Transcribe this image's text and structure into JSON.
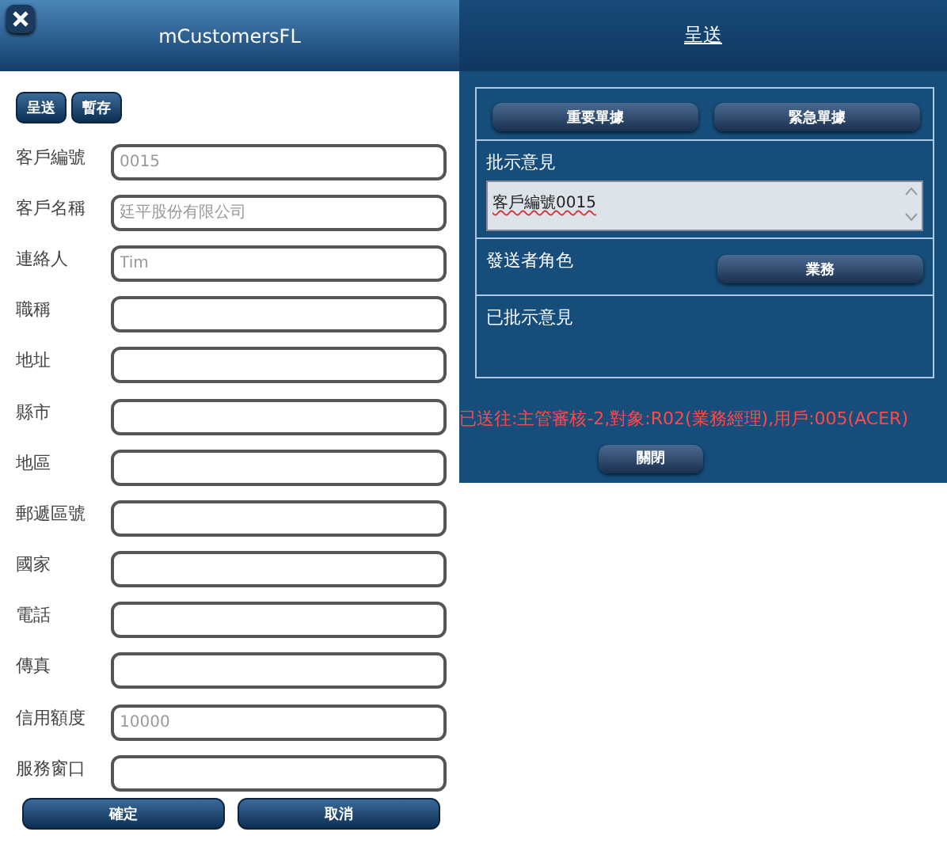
{
  "left": {
    "title": "mCustomersFL",
    "toolbar": [
      "呈送",
      "暫存"
    ],
    "fields": [
      {
        "label": "客戶編號",
        "value": "0015"
      },
      {
        "label": "客戶名稱",
        "value": "廷平股份有限公司"
      },
      {
        "label": "連絡人",
        "value": "Tim"
      },
      {
        "label": "職稱"
      },
      {
        "label": "地址"
      },
      {
        "label": "縣市"
      },
      {
        "label": "地區"
      },
      {
        "label": "郵遞區號"
      },
      {
        "label": "國家"
      },
      {
        "label": "電話"
      },
      {
        "label": "傳真"
      },
      {
        "label": "信用額度",
        "value": "10000"
      },
      {
        "label": "服務窗口"
      }
    ],
    "buttons": [
      "確定",
      "取消"
    ]
  },
  "right": {
    "title": "呈送",
    "priority_buttons": [
      "重要單據",
      "緊急單據"
    ],
    "comment_label": "批示意見",
    "comment_value": "客戶編號0015",
    "role_label": "發送者角色",
    "role_button": "業務",
    "approved_label": "已批示意見",
    "message": "已送往:主管審核-2,對象:R02(業務經理),用戶:005(ACER)",
    "close_button": "關閉"
  }
}
